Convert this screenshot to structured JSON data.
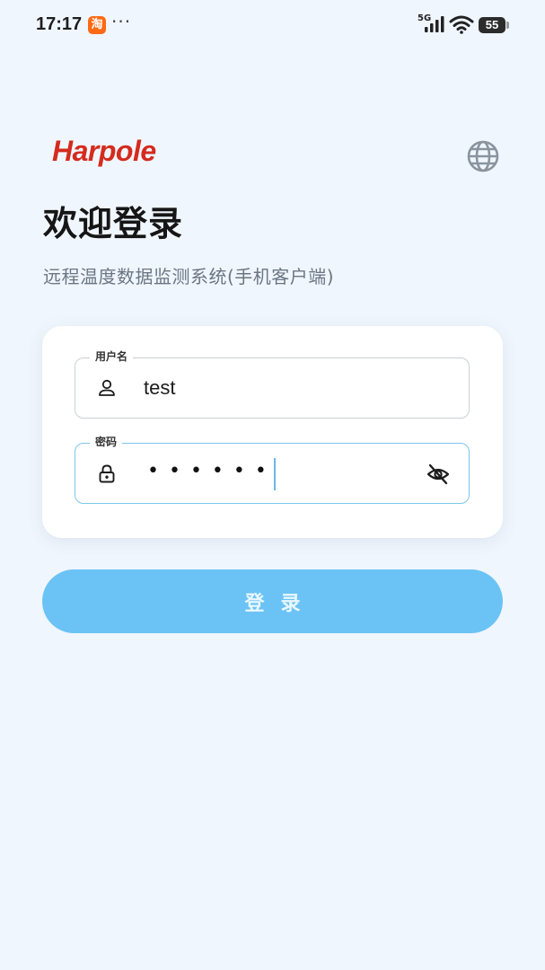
{
  "status_bar": {
    "time": "17:17",
    "app_badge": "淘",
    "more": "···",
    "network": "5G",
    "battery": "55"
  },
  "brand": {
    "logo_text": "Harpole",
    "logo_color": "#d42b1e"
  },
  "header": {
    "title": "欢迎登录",
    "subtitle": "远程温度数据监测系统(手机客户端)"
  },
  "form": {
    "username": {
      "label": "用户名",
      "value": "test",
      "icon": "person-icon"
    },
    "password": {
      "label": "密码",
      "masked_value": "••••••",
      "icon": "lock-icon",
      "toggle_icon": "eye-off-icon"
    }
  },
  "actions": {
    "login_label": "登录"
  },
  "colors": {
    "background": "#f0f6fd",
    "accent": "#6bc3f5",
    "focus_border": "#7cc6ea"
  }
}
